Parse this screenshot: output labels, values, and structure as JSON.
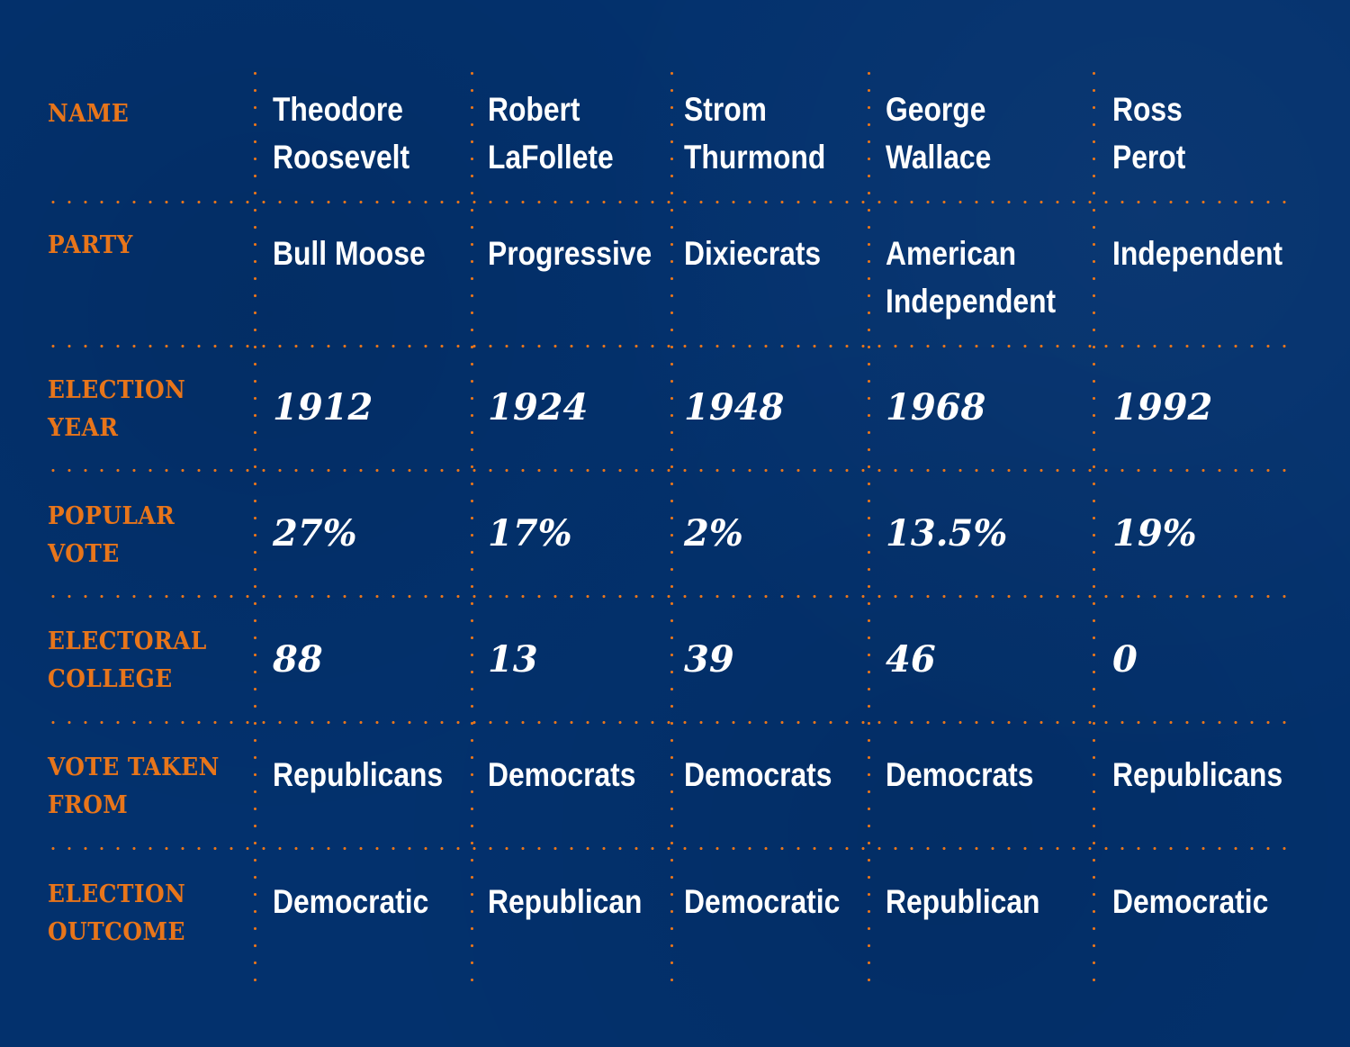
{
  "chart_data": {
    "type": "table",
    "title": "",
    "columns": [
      "Theodore Roosevelt",
      "Robert LaFollete",
      "Strom Thurmond",
      "George Wallace",
      "Ross Perot"
    ],
    "rows": [
      {
        "label": "NAME",
        "values": [
          "Theodore\nRoosevelt",
          "Robert\nLaFollete",
          "Strom\nThurmond",
          "George\nWallace",
          "Ross\nPerot"
        ]
      },
      {
        "label": "PARTY",
        "values": [
          "Bull Moose",
          "Progressive",
          "Dixiecrats",
          "American\nIndependent",
          "Independent"
        ]
      },
      {
        "label": "ELECTION\nYEAR",
        "values": [
          "1912",
          "1924",
          "1948",
          "1968",
          "1992"
        ]
      },
      {
        "label": "POPULAR\nVOTE",
        "values": [
          "27%",
          "17%",
          "2%",
          "13.5%",
          "19%"
        ]
      },
      {
        "label": "ELECTORAL\nCOLLEGE",
        "values": [
          "88",
          "13",
          "39",
          "46",
          "0"
        ]
      },
      {
        "label": "VOTE TAKEN\nFROM",
        "values": [
          "Republicans",
          "Democrats",
          "Democrats",
          "Democrats",
          "Republicans"
        ]
      },
      {
        "label": "ELECTION\nOUTCOME",
        "values": [
          "Democratic",
          "Republican",
          "Democratic",
          "Republican",
          "Democratic"
        ]
      }
    ],
    "numeric": {
      "election_year": [
        1912,
        1924,
        1948,
        1968,
        1992
      ],
      "popular_vote_pct": [
        27,
        17,
        2,
        13.5,
        19
      ],
      "electoral_college": [
        88,
        13,
        39,
        46,
        0
      ]
    }
  },
  "colors": {
    "background": "#03316d",
    "label": "#e8751a",
    "text": "#ffffff",
    "divider": "#e8751a"
  }
}
